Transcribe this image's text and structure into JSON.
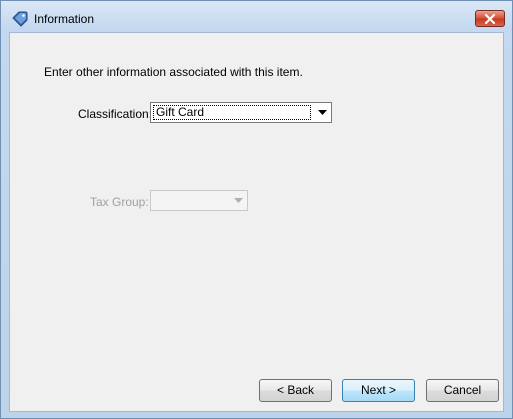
{
  "window": {
    "title": "Information",
    "close_icon": "close-icon"
  },
  "content": {
    "instruction": "Enter other information associated with this item.",
    "classification": {
      "label": "Classification:",
      "value": "Gift Card"
    },
    "tax_group": {
      "label": "Tax Group:",
      "value": ""
    }
  },
  "buttons": {
    "back": "< Back",
    "next": "Next >",
    "cancel": "Cancel"
  }
}
